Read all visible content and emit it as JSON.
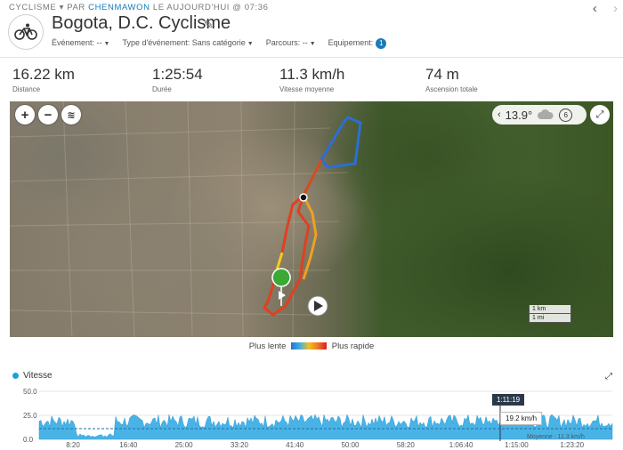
{
  "header": {
    "activity_type": "CYCLISME",
    "by_prefix": "PAR",
    "author": "CHENMAWON",
    "date_text": "LE AUJOURD'HUI @ 07:36",
    "title": "Bogota, D.C. Cyclisme",
    "nav_prev": "‹",
    "nav_next": "›",
    "meta": {
      "event_label": "Événement: --",
      "event_type_label": "Type d'événement: Sans catégorie",
      "course_label": "Parcours: --",
      "gear_label": "Equipement:",
      "gear_count": "1"
    }
  },
  "stats": [
    {
      "value": "16.22 km",
      "label": "Distance"
    },
    {
      "value": "1:25:54",
      "label": "Durée"
    },
    {
      "value": "11.3 km/h",
      "label": "Vitesse moyenne"
    },
    {
      "value": "74 m",
      "label": "Ascension totale"
    }
  ],
  "map": {
    "zoom_in": "+",
    "zoom_out": "−",
    "weather": {
      "temperature": "13.9°",
      "wind": "6"
    },
    "scale_km": "1 km",
    "scale_mi": "1 mi"
  },
  "legend": {
    "slow": "Plus lente",
    "fast": "Plus rapide"
  },
  "speed_chart": {
    "title": "Vitesse",
    "series_color": "#1aa0e0",
    "y_ticks": [
      "50.0",
      "25.0",
      "0.0"
    ],
    "x_ticks": [
      "8:20",
      "16:40",
      "25:00",
      "33:20",
      "41:40",
      "50:00",
      "58:20",
      "1:06:40",
      "1:15:00",
      "1:23:20"
    ],
    "tooltip_time": "1:11:19",
    "tooltip_speed": "19.2 km/h",
    "average_label": "Moyenne : 11.3 km/h"
  },
  "colors": {
    "accent": "#1a7bb9",
    "route_fast": "#d82020",
    "route_slow": "#2b6fd3"
  }
}
